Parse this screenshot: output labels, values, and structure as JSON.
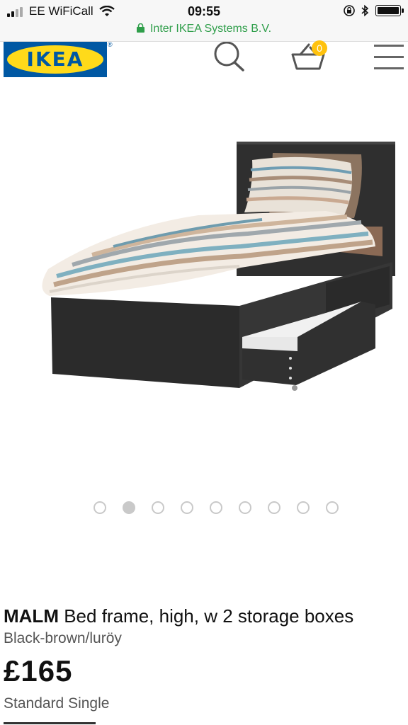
{
  "status_bar": {
    "carrier": "EE WiFiCall",
    "time": "09:55",
    "url": "Inter IKEA Systems B.V."
  },
  "header": {
    "logo_text": "IKEA",
    "basket_count": "0",
    "brand_colors": {
      "blue": "#0058a3",
      "yellow": "#ffda1a",
      "badge": "#ffc20e"
    }
  },
  "carousel": {
    "total": 9,
    "active_index": 1
  },
  "product": {
    "name": "MALM",
    "description": "Bed frame, high, w 2 storage boxes",
    "color": "Black-brown/luröy",
    "price": "£165",
    "size": "Standard Single"
  }
}
